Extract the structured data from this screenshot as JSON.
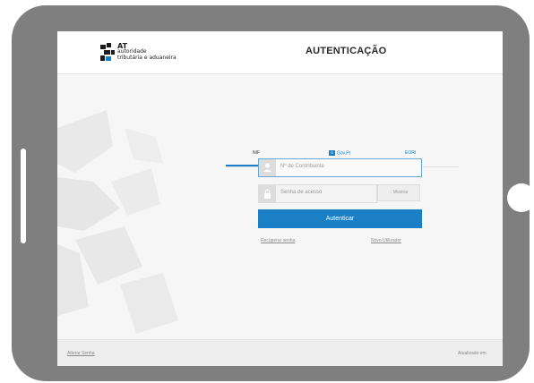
{
  "header": {
    "logo_at": "AT",
    "logo_line1": "autoridade",
    "logo_line2": "tributária e aduaneira",
    "title": "AUTENTICAÇÃO"
  },
  "tabs": [
    {
      "label": "NIF",
      "active": true
    },
    {
      "label": "Gov.Pt",
      "badge": "G",
      "active": false
    },
    {
      "label": "EORI",
      "active": false
    }
  ],
  "form": {
    "nif_placeholder": "Nº de Contribuinte",
    "password_placeholder": "Senha de acesso",
    "show_label": "Mostrar",
    "submit_label": "Autenticar"
  },
  "links": {
    "recover": "Recuperar senha",
    "new_user": "Novo Utilizador"
  },
  "footer": {
    "left": "Alterar Senha",
    "right": "Atualizado em"
  },
  "colors": {
    "accent": "#1a7fc4",
    "tablet": "#7f7f7f"
  },
  "icons": [
    "user-icon",
    "lock-icon",
    "eye-icon"
  ]
}
